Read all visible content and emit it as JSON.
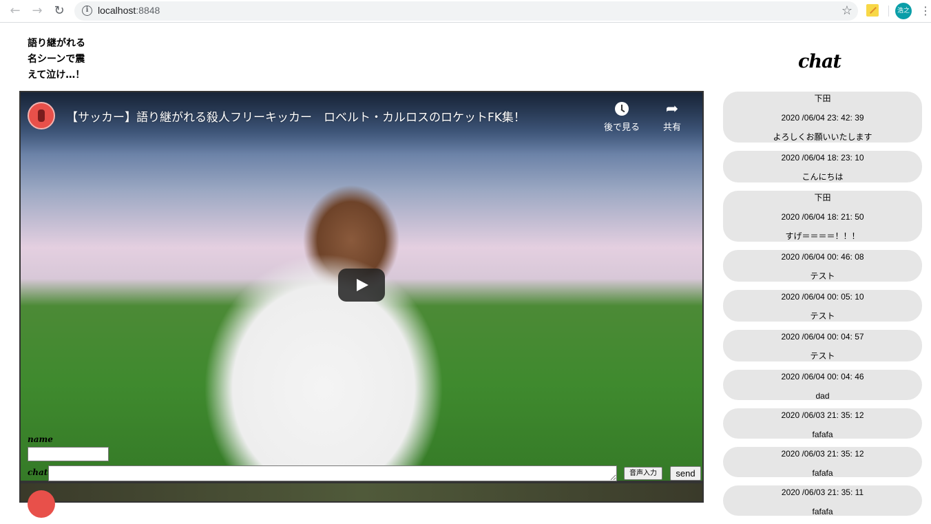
{
  "browser": {
    "url_host": "localhost",
    "url_port": ":8848",
    "profile_initials": "浩之"
  },
  "page": {
    "heading": "語り継がれる\n名シーンで震\nえて泣け…！"
  },
  "video": {
    "title": "【サッカー】語り継がれる殺人フリーキッカー　ロベルト・カルロスのロケットFK集！",
    "watch_later_label": "後で見る",
    "share_label": "共有"
  },
  "form": {
    "name_label": "name",
    "chat_label": "chat",
    "name_value": "",
    "chat_value": "",
    "voice_button": "音声入力",
    "send_button": "send"
  },
  "chat": {
    "title": "chat",
    "messages": [
      {
        "lines": [
          "下田",
          "2020 /06/04 23: 42: 39",
          "よろしくお願いいたします"
        ]
      },
      {
        "lines": [
          "2020 /06/04 18: 23: 10",
          "こんにちは"
        ]
      },
      {
        "lines": [
          "下田",
          "2020 /06/04 18: 21: 50",
          "すげ＝＝＝＝！！！"
        ]
      },
      {
        "lines": [
          "2020 /06/04 00: 46: 08",
          "テスト"
        ]
      },
      {
        "lines": [
          "2020 /06/04 00: 05: 10",
          "テスト"
        ]
      },
      {
        "lines": [
          "2020 /06/04 00: 04: 57",
          "テスト"
        ]
      },
      {
        "lines": [
          "2020 /06/04 00: 04: 46",
          "dad"
        ]
      },
      {
        "lines": [
          "2020 /06/03 21: 35: 12",
          "fafafa"
        ]
      },
      {
        "lines": [
          "2020 /06/03 21: 35: 12",
          "fafafa"
        ]
      },
      {
        "lines": [
          "2020 /06/03 21: 35: 11",
          "fafafa"
        ]
      }
    ]
  }
}
